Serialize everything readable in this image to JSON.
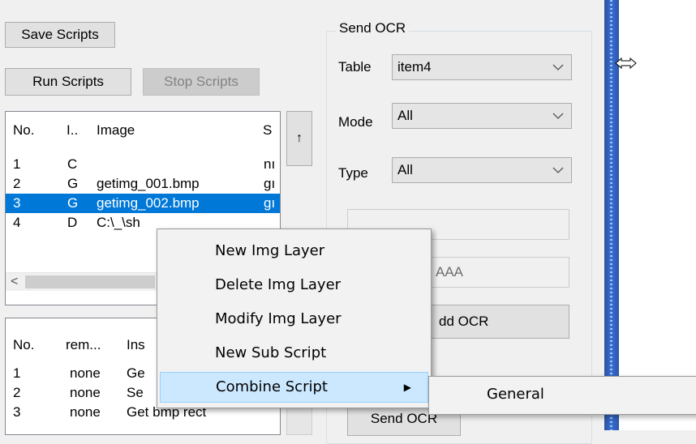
{
  "left": {
    "save_scripts": "Save Scripts",
    "run_scripts": "Run Scripts",
    "stop_scripts": "Stop Scripts",
    "scroll_up_glyph": "↑",
    "scroll_left_glyph": "<",
    "images_table": {
      "headers": [
        "No.",
        "I..",
        "Image",
        "S"
      ],
      "rows": [
        [
          "1",
          "C",
          "",
          "nı"
        ],
        [
          "2",
          "G",
          "getimg_001.bmp",
          "gı"
        ],
        [
          "3",
          "G",
          "getimg_002.bmp",
          "gı"
        ],
        [
          "4",
          "D",
          "C:\\_\\sh",
          ""
        ]
      ]
    },
    "steps_table": {
      "headers": [
        "No.",
        "rem...",
        "Ins"
      ],
      "rows": [
        [
          "1",
          "none",
          "Ge"
        ],
        [
          "2",
          "none",
          "Se"
        ],
        [
          "3",
          "none",
          "Get bmp rect"
        ]
      ]
    }
  },
  "send_ocr": {
    "group_title": "Send OCR",
    "table_label": "Table",
    "table_value": "item4",
    "mode_label": "Mode",
    "mode_value": "All",
    "type_label": "Type",
    "type_value": "All",
    "text_field_2": "AAA",
    "add_ocr_label": "dd OCR",
    "send_ocr_label": "Send OCR"
  },
  "context_menu": {
    "items": [
      "New Img Layer",
      "Delete Img Layer",
      "Modify Img Layer",
      "New Sub Script",
      "Combine Script"
    ],
    "submenu_arrow": "▶",
    "submenu": [
      "General"
    ]
  },
  "colors": {
    "selection": "#0078d7",
    "menu_highlight": "#cce8ff",
    "splitter": "#2f5fb6"
  }
}
